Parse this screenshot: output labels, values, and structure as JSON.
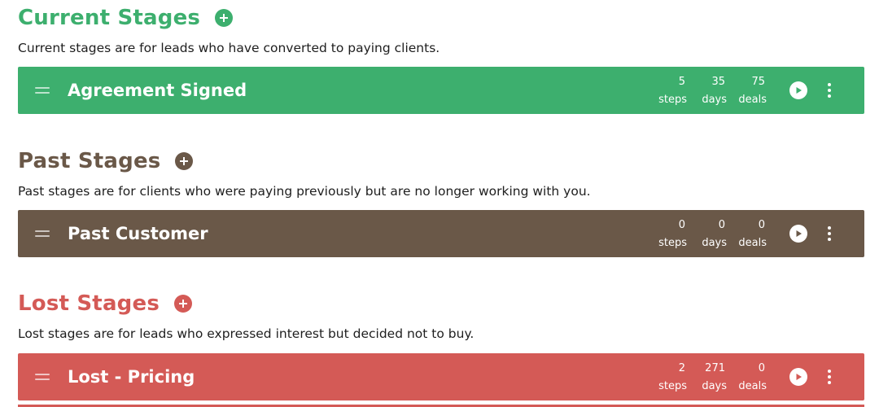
{
  "colors": {
    "current": "#3daf6e",
    "past": "#6a5848",
    "lost": "#d45a56"
  },
  "sections": {
    "current": {
      "title": "Current Stages",
      "description": "Current stages are for leads who have converted to paying clients.",
      "stage": {
        "name": "Agreement Signed",
        "steps": "5",
        "days": "35",
        "deals": "75",
        "steps_label": "steps",
        "days_label": "days",
        "deals_label": "deals"
      }
    },
    "past": {
      "title": "Past Stages",
      "description": "Past stages are for clients who were paying previously but are no longer working with you.",
      "stage": {
        "name": "Past Customer",
        "steps": "0",
        "days": "0",
        "deals": "0",
        "steps_label": "steps",
        "days_label": "days",
        "deals_label": "deals"
      }
    },
    "lost": {
      "title": "Lost Stages",
      "description": "Lost stages are for leads who expressed interest but decided not to buy.",
      "stage": {
        "name": "Lost - Pricing",
        "steps": "2",
        "days": "271",
        "deals": "0",
        "steps_label": "steps",
        "days_label": "days",
        "deals_label": "deals"
      }
    }
  },
  "icons": {
    "add": "plus-circle-icon",
    "play": "play-circle-icon",
    "menu": "more-vertical-icon",
    "drag": "drag-handle-icon"
  }
}
